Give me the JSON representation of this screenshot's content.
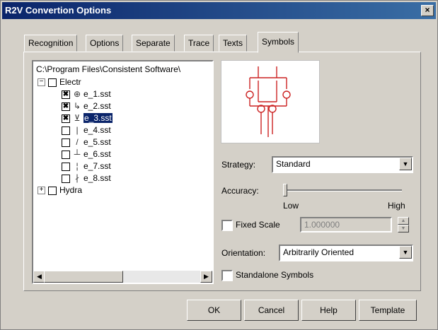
{
  "window": {
    "title": "R2V Convertion Options",
    "close_glyph": "×"
  },
  "tabs": [
    {
      "label": "Recognition",
      "active": false
    },
    {
      "label": "Options",
      "active": false
    },
    {
      "label": "Separate",
      "active": false
    },
    {
      "label": "Trace",
      "active": false
    },
    {
      "label": "Texts",
      "active": false
    },
    {
      "label": "Symbols",
      "active": true
    }
  ],
  "tree": {
    "path": "C:\\Program Files\\Consistent Software\\",
    "root1": {
      "expander": "−",
      "label": "Electr"
    },
    "items": [
      {
        "label": "e_1.sst",
        "checked": true,
        "check_glyph": "✖",
        "icon": "⊕",
        "selected": false
      },
      {
        "label": "e_2.sst",
        "checked": true,
        "check_glyph": "✖",
        "icon": "↳",
        "selected": false
      },
      {
        "label": "e_3.sst",
        "checked": true,
        "check_glyph": "✖",
        "icon": "⊻",
        "selected": true
      },
      {
        "label": "e_4.sst",
        "checked": false,
        "check_glyph": "",
        "icon": "|",
        "selected": false
      },
      {
        "label": "e_5.sst",
        "checked": false,
        "check_glyph": "",
        "icon": "/",
        "selected": false
      },
      {
        "label": "e_6.sst",
        "checked": false,
        "check_glyph": "",
        "icon": "┴",
        "selected": false
      },
      {
        "label": "e_7.sst",
        "checked": false,
        "check_glyph": "",
        "icon": "¦",
        "selected": false
      },
      {
        "label": "e_8.sst",
        "checked": false,
        "check_glyph": "",
        "icon": "∤",
        "selected": false
      }
    ],
    "root2": {
      "expander": "+",
      "label": "Hydra"
    },
    "scroll_left": "◀",
    "scroll_right": "▶"
  },
  "strategy": {
    "label": "Strategy:",
    "value": "Standard"
  },
  "accuracy": {
    "label": "Accuracy:",
    "low": "Low",
    "high": "High",
    "level": 0.0
  },
  "fixed_scale": {
    "label": "Fixed Scale",
    "checked": false,
    "value": "1.000000"
  },
  "orientation": {
    "label": "Orientation:",
    "value": "Arbitrarily Oriented"
  },
  "standalone": {
    "label": "Standalone Symbols",
    "checked": false
  },
  "combo_arrow": "▼",
  "spin_up": "▲",
  "spin_down": "▼",
  "buttons": {
    "ok": "OK",
    "cancel": "Cancel",
    "help": "Help",
    "template": "Template"
  },
  "colors": {
    "title_start": "#0a246a",
    "title_end": "#3a6ea5",
    "symbol": "#cc2222",
    "selection": "#0a246a"
  }
}
